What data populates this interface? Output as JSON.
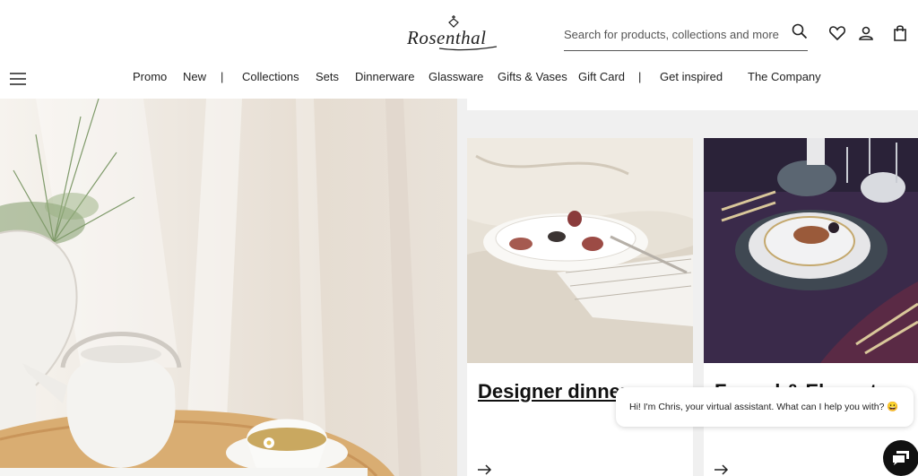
{
  "brand": {
    "logo_text": "Rosenthal"
  },
  "search": {
    "placeholder": "Search for products, collections and more..."
  },
  "header_icons": [
    "search-icon",
    "heart-icon",
    "user-icon",
    "shopping-bag-icon",
    "menu-icon"
  ],
  "nav": {
    "items": [
      "Promo",
      "New",
      "|",
      "Collections",
      "Sets",
      "Dinnerware",
      "Glassware",
      "Gifts & Vases",
      "Gift Card",
      "|",
      "Get inspired",
      "The Company"
    ]
  },
  "cards": [
    {
      "title": "Designer dinner"
    },
    {
      "title": "Formal & Elegant"
    }
  ],
  "chat": {
    "message": "Hi! I'm Chris, your virtual assistant. What can I help you with? 😀"
  }
}
